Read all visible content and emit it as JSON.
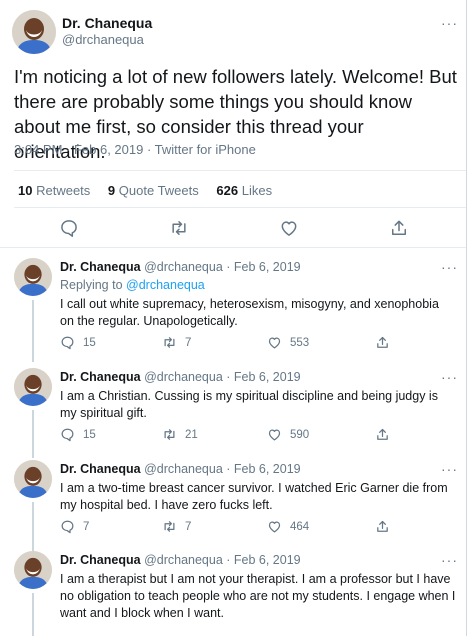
{
  "main": {
    "name": "Dr. Chanequa",
    "handle": "@drchanequa",
    "text": "I'm noticing a lot of new followers lately. Welcome! But there are probably some things you should know about me first, so consider this thread your orientation.",
    "meta": "3:04 PM · Feb 6, 2019 · Twitter for iPhone",
    "stats": {
      "retweets_count": "10",
      "retweets_label": "Retweets",
      "quote_count": "9",
      "quote_label": "Quote Tweets",
      "likes_count": "626",
      "likes_label": "Likes"
    },
    "more": "···"
  },
  "replies": [
    {
      "name": "Dr. Chanequa",
      "handle_date": "@drchanequa · Feb 6, 2019",
      "replying_prefix": "Replying to",
      "replying_handle": "@drchanequa",
      "text": "I call out white supremacy, heterosexism, misogyny, and xenophobia on the regular. Unapologetically.",
      "replies": "15",
      "retweets": "7",
      "likes": "553"
    },
    {
      "name": "Dr. Chanequa",
      "handle_date": "@drchanequa · Feb 6, 2019",
      "text": "I am a Christian. Cussing is my spiritual discipline and being judgy is my spiritual gift.",
      "replies": "15",
      "retweets": "21",
      "likes": "590"
    },
    {
      "name": "Dr. Chanequa",
      "handle_date": "@drchanequa · Feb 6, 2019",
      "text": "I am a two-time breast cancer survivor. I watched Eric Garner die from my hospital bed. I have zero fucks left.",
      "replies": "7",
      "retweets": "7",
      "likes": "464"
    },
    {
      "name": "Dr. Chanequa",
      "handle_date": "@drchanequa · Feb 6, 2019",
      "text": "I am a therapist but I am not your therapist. I am a professor but I have no obligation to teach people who are not my students. I engage when I want and I block when I want."
    }
  ],
  "icons": {
    "reply": "speech-bubble",
    "retweet": "retweet-arrows",
    "like": "heart",
    "share": "share-upload"
  },
  "colors": {
    "link": "#1da1f2",
    "secondary_text": "#657786",
    "thread_line": "#ccd6dd"
  }
}
